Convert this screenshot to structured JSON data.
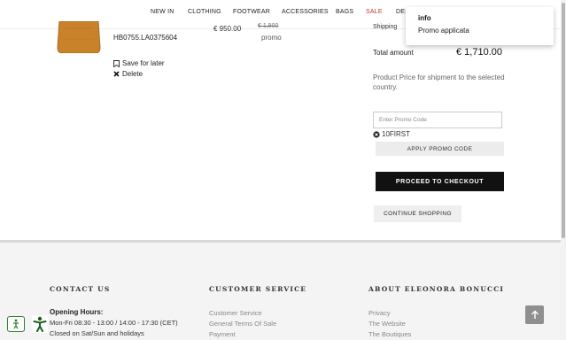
{
  "nav": {
    "items": [
      {
        "label": "NEW IN"
      },
      {
        "label": "CLOTHING"
      },
      {
        "label": "FOOTWEAR"
      },
      {
        "label": "ACCESSORIES"
      },
      {
        "label": "BAGS"
      },
      {
        "label": "SALE"
      },
      {
        "label": "DES"
      }
    ]
  },
  "product": {
    "sku": "HB0755.LA0375604",
    "price_left": "€ 950.00",
    "price_struck": "€ 1,900",
    "promo_label": "promo",
    "save_for_later": "Save for later",
    "delete": "Delete"
  },
  "summary": {
    "shipping_label": "Shipping",
    "total_label": "Total amount",
    "total_value": "€ 1,710.00",
    "shipping_note": "Product Price for shipment to the selected country.",
    "promo_placeholder": "Enter Promo Code",
    "applied_code": "10FIRST",
    "apply_label": "APPLY PROMO CODE",
    "checkout_label": "PROCEED TO CHECKOUT",
    "continue_label": "CONTINUE SHOPPING"
  },
  "toast": {
    "title": "info",
    "message": "Promo applicata"
  },
  "footer": {
    "contact": {
      "heading": "CONTACT US",
      "hours_label": "Opening Hours:",
      "hours": "Mon-Fri 08:30 - 13:00 / 14:00 - 17:30 (CET)",
      "closed": "Closed on Sat/Sun and holidays"
    },
    "service": {
      "heading": "CUSTOMER SERVICE",
      "links": [
        "Customer Service",
        "General Terms Of Sale",
        "Payment"
      ]
    },
    "about": {
      "heading": "ABOUT ELEONORA BONUCCI",
      "links": [
        "Privacy",
        "The Website",
        "The Boutiques"
      ]
    }
  },
  "colors": {
    "accent_sale": "#c0392b",
    "checkout_bg": "#111111",
    "bag": "#c9822a"
  }
}
